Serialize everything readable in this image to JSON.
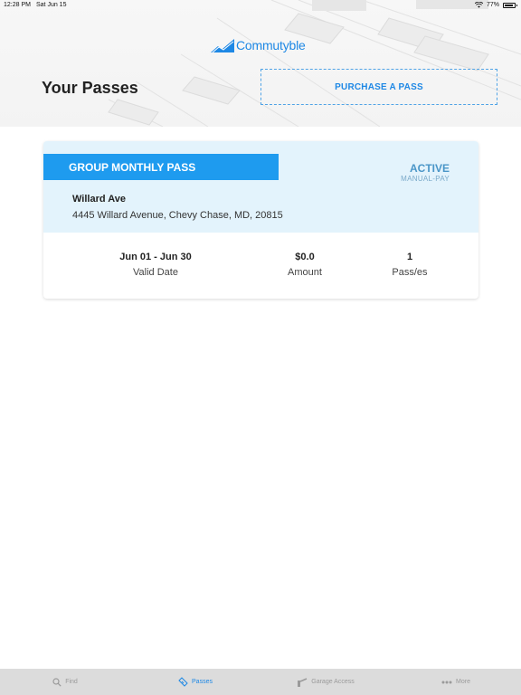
{
  "status_bar": {
    "time": "12:28 PM",
    "date": "Sat Jun 15",
    "battery": "77%"
  },
  "brand": {
    "name": "Commutyble",
    "color": "#1e88e5"
  },
  "header": {
    "title": "Your Passes",
    "purchase_label": "PURCHASE A PASS"
  },
  "pass": {
    "type": "GROUP MONTHLY PASS",
    "status": "ACTIVE",
    "payment_mode": "MANUAL-PAY",
    "location_name": "Willard Ave",
    "location_address": "4445 Willard Avenue, Chevy Chase, MD, 20815",
    "stats": [
      {
        "value": "Jun 01 - Jun 30",
        "label": "Valid Date"
      },
      {
        "value": "$0.0",
        "label": "Amount"
      },
      {
        "value": "1",
        "label": "Pass/es"
      }
    ]
  },
  "tabs": [
    {
      "label": "Find",
      "icon": "search-icon",
      "active": false
    },
    {
      "label": "Passes",
      "icon": "ticket-icon",
      "active": true
    },
    {
      "label": "Garage Access",
      "icon": "gate-icon",
      "active": false
    },
    {
      "label": "More",
      "icon": "more-dots-icon",
      "active": false
    }
  ],
  "colors": {
    "accent": "#1e88e5",
    "banner": "#1e9bef",
    "card_tint": "#e3f3fc",
    "status_text": "#4a96c8"
  }
}
